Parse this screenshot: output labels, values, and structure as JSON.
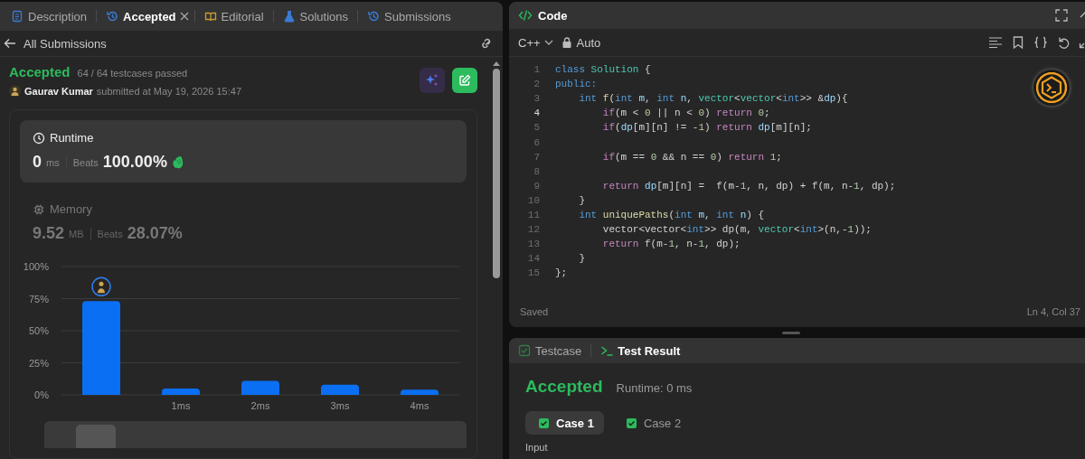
{
  "left_panel": {
    "tabs": [
      {
        "label": "Description",
        "kind": "document",
        "selected": false,
        "closable": false
      },
      {
        "label": "Accepted",
        "kind": "history",
        "selected": true,
        "closable": true
      },
      {
        "label": "Editorial",
        "kind": "book",
        "selected": false,
        "closable": false
      },
      {
        "label": "Solutions",
        "kind": "flask",
        "selected": false,
        "closable": false
      },
      {
        "label": "Submissions",
        "kind": "history",
        "selected": false,
        "closable": false
      }
    ],
    "back_label": "All Submissions",
    "submission": {
      "status": "Accepted",
      "testcases": "64 / 64 testcases passed",
      "user": "Gaurav Kumar",
      "submitted": "submitted at May 19, 2026 15:47"
    },
    "stats": [
      {
        "kind": "clock",
        "title": "Runtime",
        "value": "0",
        "unit": "ms",
        "beats_label": "Beats",
        "beats": "100.00%",
        "selected": true,
        "celebrate": true
      },
      {
        "kind": "chip",
        "title": "Memory",
        "value": "9.52",
        "unit": "MB",
        "beats_label": "Beats",
        "beats": "28.07%",
        "selected": false,
        "celebrate": false
      }
    ],
    "chart_data": {
      "type": "bar",
      "categories": [
        null,
        "1ms",
        "2ms",
        "3ms",
        "4ms"
      ],
      "values": [
        73,
        5,
        11,
        8,
        4
      ],
      "ylim": [
        0,
        100
      ],
      "grid": true,
      "yticks": [
        {
          "value": 0,
          "label": "0%"
        },
        {
          "value": 25,
          "label": "25%"
        },
        {
          "value": 50,
          "label": "50%"
        },
        {
          "value": 75,
          "label": "75%"
        },
        {
          "value": 100,
          "label": "100%"
        }
      ]
    }
  },
  "code_panel": {
    "title": "Code",
    "language": "C++",
    "mode": "Auto",
    "lines": [
      {
        "n": "1",
        "active": false,
        "tokens": [
          {
            "text": "class ",
            "kind": "keyword"
          },
          {
            "text": "Solution",
            "kind": "type"
          },
          {
            "text": " {",
            "kind": "plain"
          }
        ]
      },
      {
        "n": "2",
        "active": false,
        "tokens": [
          {
            "text": "public:",
            "kind": "keyword"
          }
        ]
      },
      {
        "n": "3",
        "active": false,
        "tokens": [
          {
            "text": "    int ",
            "kind": "keyword"
          },
          {
            "text": "f",
            "kind": "function"
          },
          {
            "text": "(",
            "kind": "plain"
          },
          {
            "text": "int ",
            "kind": "keyword"
          },
          {
            "text": "m",
            "kind": "variable"
          },
          {
            "text": ", ",
            "kind": "plain"
          },
          {
            "text": "int ",
            "kind": "keyword"
          },
          {
            "text": "n",
            "kind": "variable"
          },
          {
            "text": ", ",
            "kind": "plain"
          },
          {
            "text": "vector",
            "kind": "type"
          },
          {
            "text": "<",
            "kind": "plain"
          },
          {
            "text": "vector",
            "kind": "type"
          },
          {
            "text": "<",
            "kind": "plain"
          },
          {
            "text": "int",
            "kind": "keyword"
          },
          {
            "text": ">> &",
            "kind": "plain"
          },
          {
            "text": "dp",
            "kind": "variable"
          },
          {
            "text": "){",
            "kind": "plain"
          }
        ]
      },
      {
        "n": "4",
        "active": true,
        "tokens": [
          {
            "text": "        if",
            "kind": "control"
          },
          {
            "text": "(m < ",
            "kind": "plain"
          },
          {
            "text": "0",
            "kind": "number"
          },
          {
            "text": " || n < ",
            "kind": "plain"
          },
          {
            "text": "0",
            "kind": "number"
          },
          {
            "text": ") ",
            "kind": "plain"
          },
          {
            "text": "return ",
            "kind": "control"
          },
          {
            "text": "0",
            "kind": "number"
          },
          {
            "text": ";",
            "kind": "plain"
          }
        ]
      },
      {
        "n": "5",
        "active": false,
        "tokens": [
          {
            "text": "        if",
            "kind": "control"
          },
          {
            "text": "(",
            "kind": "plain"
          },
          {
            "text": "dp",
            "kind": "variable"
          },
          {
            "text": "[m][n] != -",
            "kind": "plain"
          },
          {
            "text": "1",
            "kind": "number"
          },
          {
            "text": ") ",
            "kind": "plain"
          },
          {
            "text": "return ",
            "kind": "control"
          },
          {
            "text": "dp",
            "kind": "variable"
          },
          {
            "text": "[m][n];",
            "kind": "plain"
          }
        ]
      },
      {
        "n": "6",
        "active": false
      },
      {
        "n": "7",
        "active": false,
        "tokens": [
          {
            "text": "        if",
            "kind": "control"
          },
          {
            "text": "(m == ",
            "kind": "plain"
          },
          {
            "text": "0",
            "kind": "number"
          },
          {
            "text": " && n == ",
            "kind": "plain"
          },
          {
            "text": "0",
            "kind": "number"
          },
          {
            "text": ") ",
            "kind": "plain"
          },
          {
            "text": "return ",
            "kind": "control"
          },
          {
            "text": "1",
            "kind": "number"
          },
          {
            "text": ";",
            "kind": "plain"
          }
        ]
      },
      {
        "n": "8",
        "active": false
      },
      {
        "n": "9",
        "active": false,
        "tokens": [
          {
            "text": "        return ",
            "kind": "control"
          },
          {
            "text": "dp",
            "kind": "variable"
          },
          {
            "text": "[m][n] =  f(m-",
            "kind": "plain"
          },
          {
            "text": "1",
            "kind": "number"
          },
          {
            "text": ", n, dp) + f(m, n-",
            "kind": "plain"
          },
          {
            "text": "1",
            "kind": "number"
          },
          {
            "text": ", dp);",
            "kind": "plain"
          }
        ]
      },
      {
        "n": "10",
        "active": false,
        "tokens": [
          {
            "text": "    }",
            "kind": "plain"
          }
        ]
      },
      {
        "n": "11",
        "active": false,
        "tokens": [
          {
            "text": "    int ",
            "kind": "keyword"
          },
          {
            "text": "uniquePaths",
            "kind": "function"
          },
          {
            "text": "(",
            "kind": "plain"
          },
          {
            "text": "int ",
            "kind": "keyword"
          },
          {
            "text": "m",
            "kind": "variable"
          },
          {
            "text": ", ",
            "kind": "plain"
          },
          {
            "text": "int ",
            "kind": "keyword"
          },
          {
            "text": "n",
            "kind": "variable"
          },
          {
            "text": ") {",
            "kind": "plain"
          }
        ]
      },
      {
        "n": "12",
        "active": false,
        "tokens": [
          {
            "text": "        vector<vector<",
            "kind": "plain"
          },
          {
            "text": "int",
            "kind": "keyword"
          },
          {
            "text": ">> dp(m, ",
            "kind": "plain"
          },
          {
            "text": "vector",
            "kind": "type"
          },
          {
            "text": "<",
            "kind": "plain"
          },
          {
            "text": "int",
            "kind": "keyword"
          },
          {
            "text": ">(n,-",
            "kind": "plain"
          },
          {
            "text": "1",
            "kind": "number"
          },
          {
            "text": "));",
            "kind": "plain"
          }
        ]
      },
      {
        "n": "13",
        "active": false,
        "tokens": [
          {
            "text": "        return",
            "kind": "control"
          },
          {
            "text": " f(m-",
            "kind": "plain"
          },
          {
            "text": "1",
            "kind": "number"
          },
          {
            "text": ", n-",
            "kind": "plain"
          },
          {
            "text": "1",
            "kind": "number"
          },
          {
            "text": ", dp);",
            "kind": "plain"
          }
        ]
      },
      {
        "n": "14",
        "active": false,
        "tokens": [
          {
            "text": "    }",
            "kind": "plain"
          }
        ]
      },
      {
        "n": "15",
        "active": false,
        "tokens": [
          {
            "text": "};",
            "kind": "plain"
          }
        ]
      }
    ],
    "status": "Saved",
    "cursor": "Ln 4, Col 37"
  },
  "result_panel": {
    "tabs": [
      {
        "label": "Testcase",
        "kind": "checkbox",
        "selected": false
      },
      {
        "label": "Test Result",
        "kind": "terminal",
        "selected": true
      }
    ],
    "status": "Accepted",
    "runtime": "Runtime: 0 ms",
    "cases": [
      {
        "label": "Case 1",
        "selected": true,
        "passed": true
      },
      {
        "label": "Case 2",
        "selected": false,
        "passed": true
      }
    ],
    "input_label": "Input"
  }
}
